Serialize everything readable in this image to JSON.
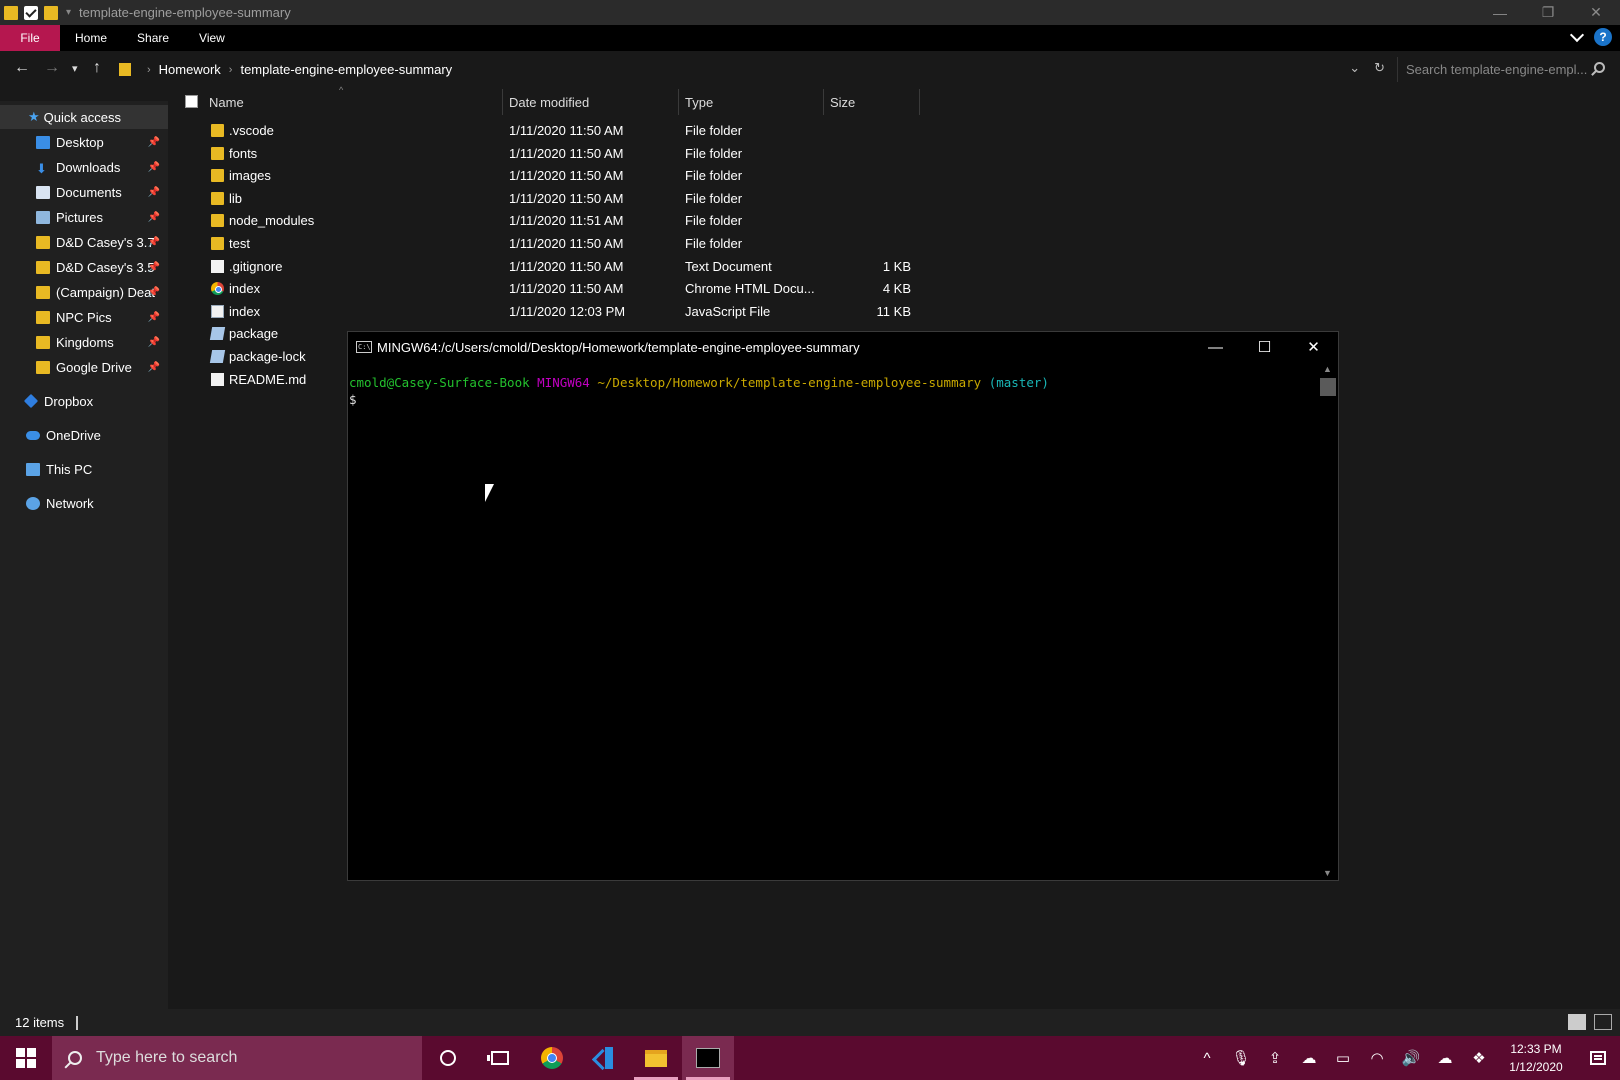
{
  "window": {
    "title": "template-engine-employee-summary",
    "controls": {
      "minimize": "—",
      "restore": "❐",
      "close": "✕"
    }
  },
  "ribbon": {
    "tabs": [
      "File",
      "Home",
      "Share",
      "View"
    ],
    "file_color": "#b5174f",
    "help": "?"
  },
  "address": {
    "crumbs": [
      "Homework",
      "template-engine-employee-summary"
    ],
    "search_placeholder": "Search template-engine-empl..."
  },
  "sidebar": {
    "quick_access": "Quick access",
    "items": [
      {
        "label": "Desktop",
        "pinned": true,
        "icon": "desktop-icon"
      },
      {
        "label": "Downloads",
        "pinned": true,
        "icon": "download-icon"
      },
      {
        "label": "Documents",
        "pinned": true,
        "icon": "documents-icon"
      },
      {
        "label": "Pictures",
        "pinned": true,
        "icon": "pictures-icon"
      },
      {
        "label": "D&D Casey's 3.7",
        "pinned": true,
        "icon": "shared-folder-icon"
      },
      {
        "label": "D&D Casey's 3.5",
        "pinned": true,
        "icon": "shared-folder-icon"
      },
      {
        "label": "(Campaign) Deat",
        "pinned": true,
        "icon": "shared-folder-icon"
      },
      {
        "label": "NPC Pics",
        "pinned": true,
        "icon": "shared-folder-icon"
      },
      {
        "label": "Kingdoms",
        "pinned": true,
        "icon": "shared-folder-icon"
      },
      {
        "label": "Google Drive",
        "pinned": true,
        "icon": "shared-folder-icon"
      }
    ],
    "locations": [
      {
        "label": "Dropbox",
        "icon": "dropbox-icon"
      },
      {
        "label": "OneDrive",
        "icon": "onedrive-icon"
      },
      {
        "label": "This PC",
        "icon": "pc-icon"
      },
      {
        "label": "Network",
        "icon": "network-icon"
      }
    ]
  },
  "filelist": {
    "columns": {
      "name": "Name",
      "date": "Date modified",
      "type": "Type",
      "size": "Size"
    },
    "rows": [
      {
        "name": ".vscode",
        "date": "1/11/2020 11:50 AM",
        "type": "File folder",
        "size": "",
        "icon": "folder"
      },
      {
        "name": "fonts",
        "date": "1/11/2020 11:50 AM",
        "type": "File folder",
        "size": "",
        "icon": "folder"
      },
      {
        "name": "images",
        "date": "1/11/2020 11:50 AM",
        "type": "File folder",
        "size": "",
        "icon": "folder"
      },
      {
        "name": "lib",
        "date": "1/11/2020 11:50 AM",
        "type": "File folder",
        "size": "",
        "icon": "folder"
      },
      {
        "name": "node_modules",
        "date": "1/11/2020 11:51 AM",
        "type": "File folder",
        "size": "",
        "icon": "folder"
      },
      {
        "name": "test",
        "date": "1/11/2020 11:50 AM",
        "type": "File folder",
        "size": "",
        "icon": "folder"
      },
      {
        "name": ".gitignore",
        "date": "1/11/2020 11:50 AM",
        "type": "Text Document",
        "size": "1 KB",
        "icon": "doc"
      },
      {
        "name": "index",
        "date": "1/11/2020 11:50 AM",
        "type": "Chrome HTML Docu...",
        "size": "4 KB",
        "icon": "chrome"
      },
      {
        "name": "index",
        "date": "1/11/2020 12:03 PM",
        "type": "JavaScript File",
        "size": "11 KB",
        "icon": "js"
      },
      {
        "name": "package",
        "date": "",
        "type": "",
        "size": "",
        "icon": "json"
      },
      {
        "name": "package-lock",
        "date": "",
        "type": "",
        "size": "",
        "icon": "json"
      },
      {
        "name": "README.md",
        "date": "",
        "type": "",
        "size": "",
        "icon": "doc"
      }
    ]
  },
  "terminal": {
    "title": "MINGW64:/c/Users/cmold/Desktop/Homework/template-engine-employee-summary",
    "user_host": "cmold@Casey-Surface-Book",
    "shell": "MINGW64",
    "path": "~/Desktop/Homework/template-engine-employee-summary",
    "branch": "(master)",
    "prompt": "$",
    "colors": {
      "user": "#23c12e",
      "shell": "#c000c0",
      "path": "#c8a800",
      "branch": "#19b6b6"
    }
  },
  "status": {
    "item_count": "12 items"
  },
  "taskbar": {
    "search_placeholder": "Type here to search",
    "time": "12:33 PM",
    "date": "1/12/2020",
    "color": "#5a0a2f"
  }
}
